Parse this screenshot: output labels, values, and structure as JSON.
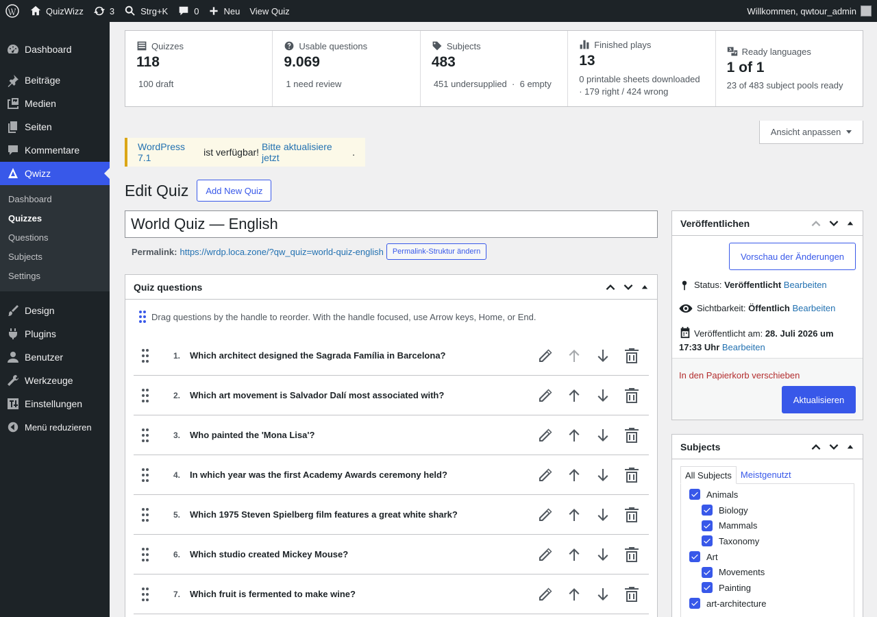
{
  "adminbar": {
    "site_name": "QuizWizz",
    "updates_count": "3",
    "search_shortcut": "Strg+K",
    "comments_count": "0",
    "new_label": "Neu",
    "view_label": "View Quiz",
    "greeting": "Willkommen, qwtour_admin"
  },
  "sidebar": {
    "items": [
      {
        "label": "Dashboard",
        "icon": "dashboard-icon"
      },
      {
        "label": "Beiträge",
        "icon": "pin-icon"
      },
      {
        "label": "Medien",
        "icon": "media-icon"
      },
      {
        "label": "Seiten",
        "icon": "pages-icon"
      },
      {
        "label": "Kommentare",
        "icon": "comments-icon"
      },
      {
        "label": "Qwizz",
        "icon": "qwizz-icon"
      }
    ],
    "sub_items": [
      "Dashboard",
      "Quizzes",
      "Questions",
      "Subjects",
      "Settings"
    ],
    "current_sub": "Quizzes",
    "items_bottom": [
      {
        "label": "Design",
        "icon": "brush-icon"
      },
      {
        "label": "Plugins",
        "icon": "plugin-icon"
      },
      {
        "label": "Benutzer",
        "icon": "user-icon"
      },
      {
        "label": "Werkzeuge",
        "icon": "wrench-icon"
      },
      {
        "label": "Einstellungen",
        "icon": "settings-icon"
      },
      {
        "label": "Menü reduzieren",
        "icon": "collapse-icon"
      }
    ]
  },
  "stats": [
    {
      "label": "Quizzes",
      "value": "118",
      "link1": "100 draft"
    },
    {
      "label": "Usable questions",
      "value": "9.069",
      "link1": "1 need review"
    },
    {
      "label": "Subjects",
      "value": "483",
      "link1": "451 undersupplied",
      "sep": "·",
      "link2": "6 empty"
    },
    {
      "label": "Finished plays",
      "value": "13",
      "line1": "0 printable sheets downloaded",
      "line2": "· 179 right / 424 wrong"
    },
    {
      "label": "Ready languages",
      "value": "1 of 1",
      "line1": "23 of 483 subject pools ready"
    }
  ],
  "screen_options": "Ansicht anpassen",
  "notice": {
    "link1": "WordPress 7.1",
    "text": " ist verfügbar! ",
    "link2": "Bitte aktualisiere jetzt",
    "end": "."
  },
  "page": {
    "title": "Edit Quiz",
    "add_new": "Add New Quiz",
    "quiz_title": "World Quiz — English",
    "permalink_label": "Permalink:",
    "permalink_url": "https://wrdp.loca.zone/?qw_quiz=world-quiz-english",
    "permalink_button": "Permalink-Struktur ändern"
  },
  "questions_box": {
    "title": "Quiz questions",
    "hint": "Drag questions by the handle to reorder. With the handle focused, use Arrow keys, Home, or End.",
    "rows": [
      {
        "num": "1.",
        "text": "Which architect designed the Sagrada Família in Barcelona?"
      },
      {
        "num": "2.",
        "text": "Which art movement is Salvador Dalí most associated with?"
      },
      {
        "num": "3.",
        "text": "Who painted the 'Mona Lisa'?"
      },
      {
        "num": "4.",
        "text": "In which year was the first Academy Awards ceremony held?"
      },
      {
        "num": "5.",
        "text": "Which 1975 Steven Spielberg film features a great white shark?"
      },
      {
        "num": "6.",
        "text": "Which studio created Mickey Mouse?"
      },
      {
        "num": "7.",
        "text": "Which fruit is fermented to make wine?"
      }
    ]
  },
  "publish": {
    "title": "Veröffentlichen",
    "preview": "Vorschau der Änderungen",
    "status_label": "Status: ",
    "status_value": "Veröffentlicht",
    "visibility_label": "Sichtbarkeit: ",
    "visibility_value": "Öffentlich",
    "published_label": "Veröffentlicht am: ",
    "published_value1": "28. Juli 2026 um",
    "published_value2": "17:33 Uhr",
    "edit": "Bearbeiten",
    "trash": "In den Papierkorb verschieben",
    "update": "Aktualisieren"
  },
  "subjects_box": {
    "title": "Subjects",
    "tab_all": "All Subjects",
    "tab_popular": "Meistgenutzt",
    "items": [
      {
        "label": "Animals",
        "child": false
      },
      {
        "label": "Biology",
        "child": true
      },
      {
        "label": "Mammals",
        "child": true
      },
      {
        "label": "Taxonomy",
        "child": true
      },
      {
        "label": "Art",
        "child": false
      },
      {
        "label": "Movements",
        "child": true
      },
      {
        "label": "Painting",
        "child": true
      },
      {
        "label": "art-architecture",
        "child": false
      }
    ]
  },
  "colors": {
    "accent": "#3858e9",
    "adminbar": "#1d2327",
    "notice_border": "#dba617",
    "trash": "#b32d2e"
  }
}
